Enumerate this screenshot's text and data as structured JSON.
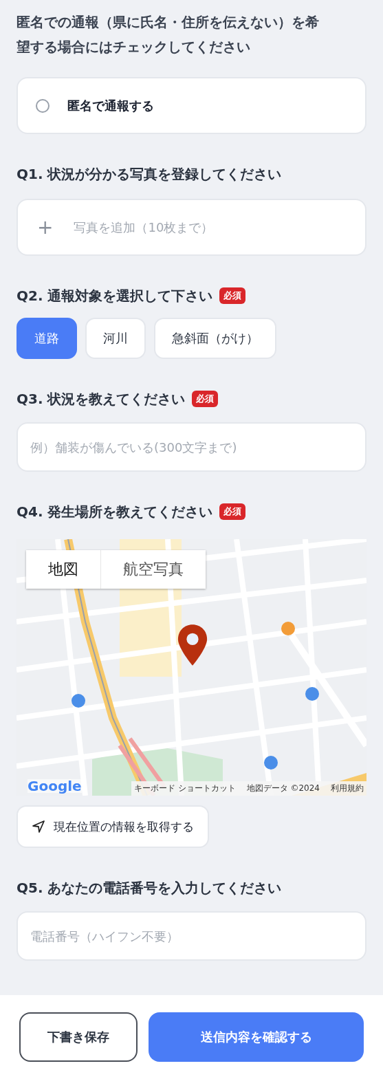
{
  "anonymous": {
    "prompt": "匿名での通報（県に氏名・住所を伝えない）を希望する場合にはチェックしてください",
    "option": {
      "label": "匿名で通報する",
      "checked": false
    }
  },
  "questions": [
    {
      "label": "Q1. 状況が分かる写真を登録してください",
      "plus": "+",
      "placeholder": "写真を追加（10枚まで）"
    },
    {
      "kind": "choice",
      "label": "Q2. 通報対象を選択して下さい",
      "badge": "必須",
      "options": [
        {
          "label": "道路",
          "selected": true
        },
        {
          "label": "河川",
          "selected": false
        },
        {
          "label": "急斜面（がけ）",
          "selected": false
        }
      ]
    },
    {
      "kind": "text",
      "label": "Q3. 状況を教えてください",
      "badge": "必須",
      "placeholder": "例）舗装が傷んでいる(300文字まで)"
    },
    {
      "kind": "map",
      "label": "Q4. 発生場所を教えてください",
      "badge": "必須",
      "map": {
        "kind": "picture",
        "tabs": [
          {
            "label": "地図",
            "selected": true
          },
          {
            "label": "航空写真",
            "selected": false
          }
        ],
        "logo": "Google",
        "attribution": [
          "キーボード ショートカット",
          "地図データ ©2024",
          "利用規約"
        ]
      },
      "locate_button": "現在位置の情報を取得する"
    },
    {
      "kind": "text",
      "label": "Q5. あなたの電話番号を入力してください",
      "placeholder": "電話番号（ハイフン不要）"
    }
  ],
  "footer": {
    "buttons": [
      {
        "label": "下書き保存",
        "kind": "secondary"
      },
      {
        "label": "送信内容を確認する",
        "kind": "primary"
      }
    ]
  }
}
